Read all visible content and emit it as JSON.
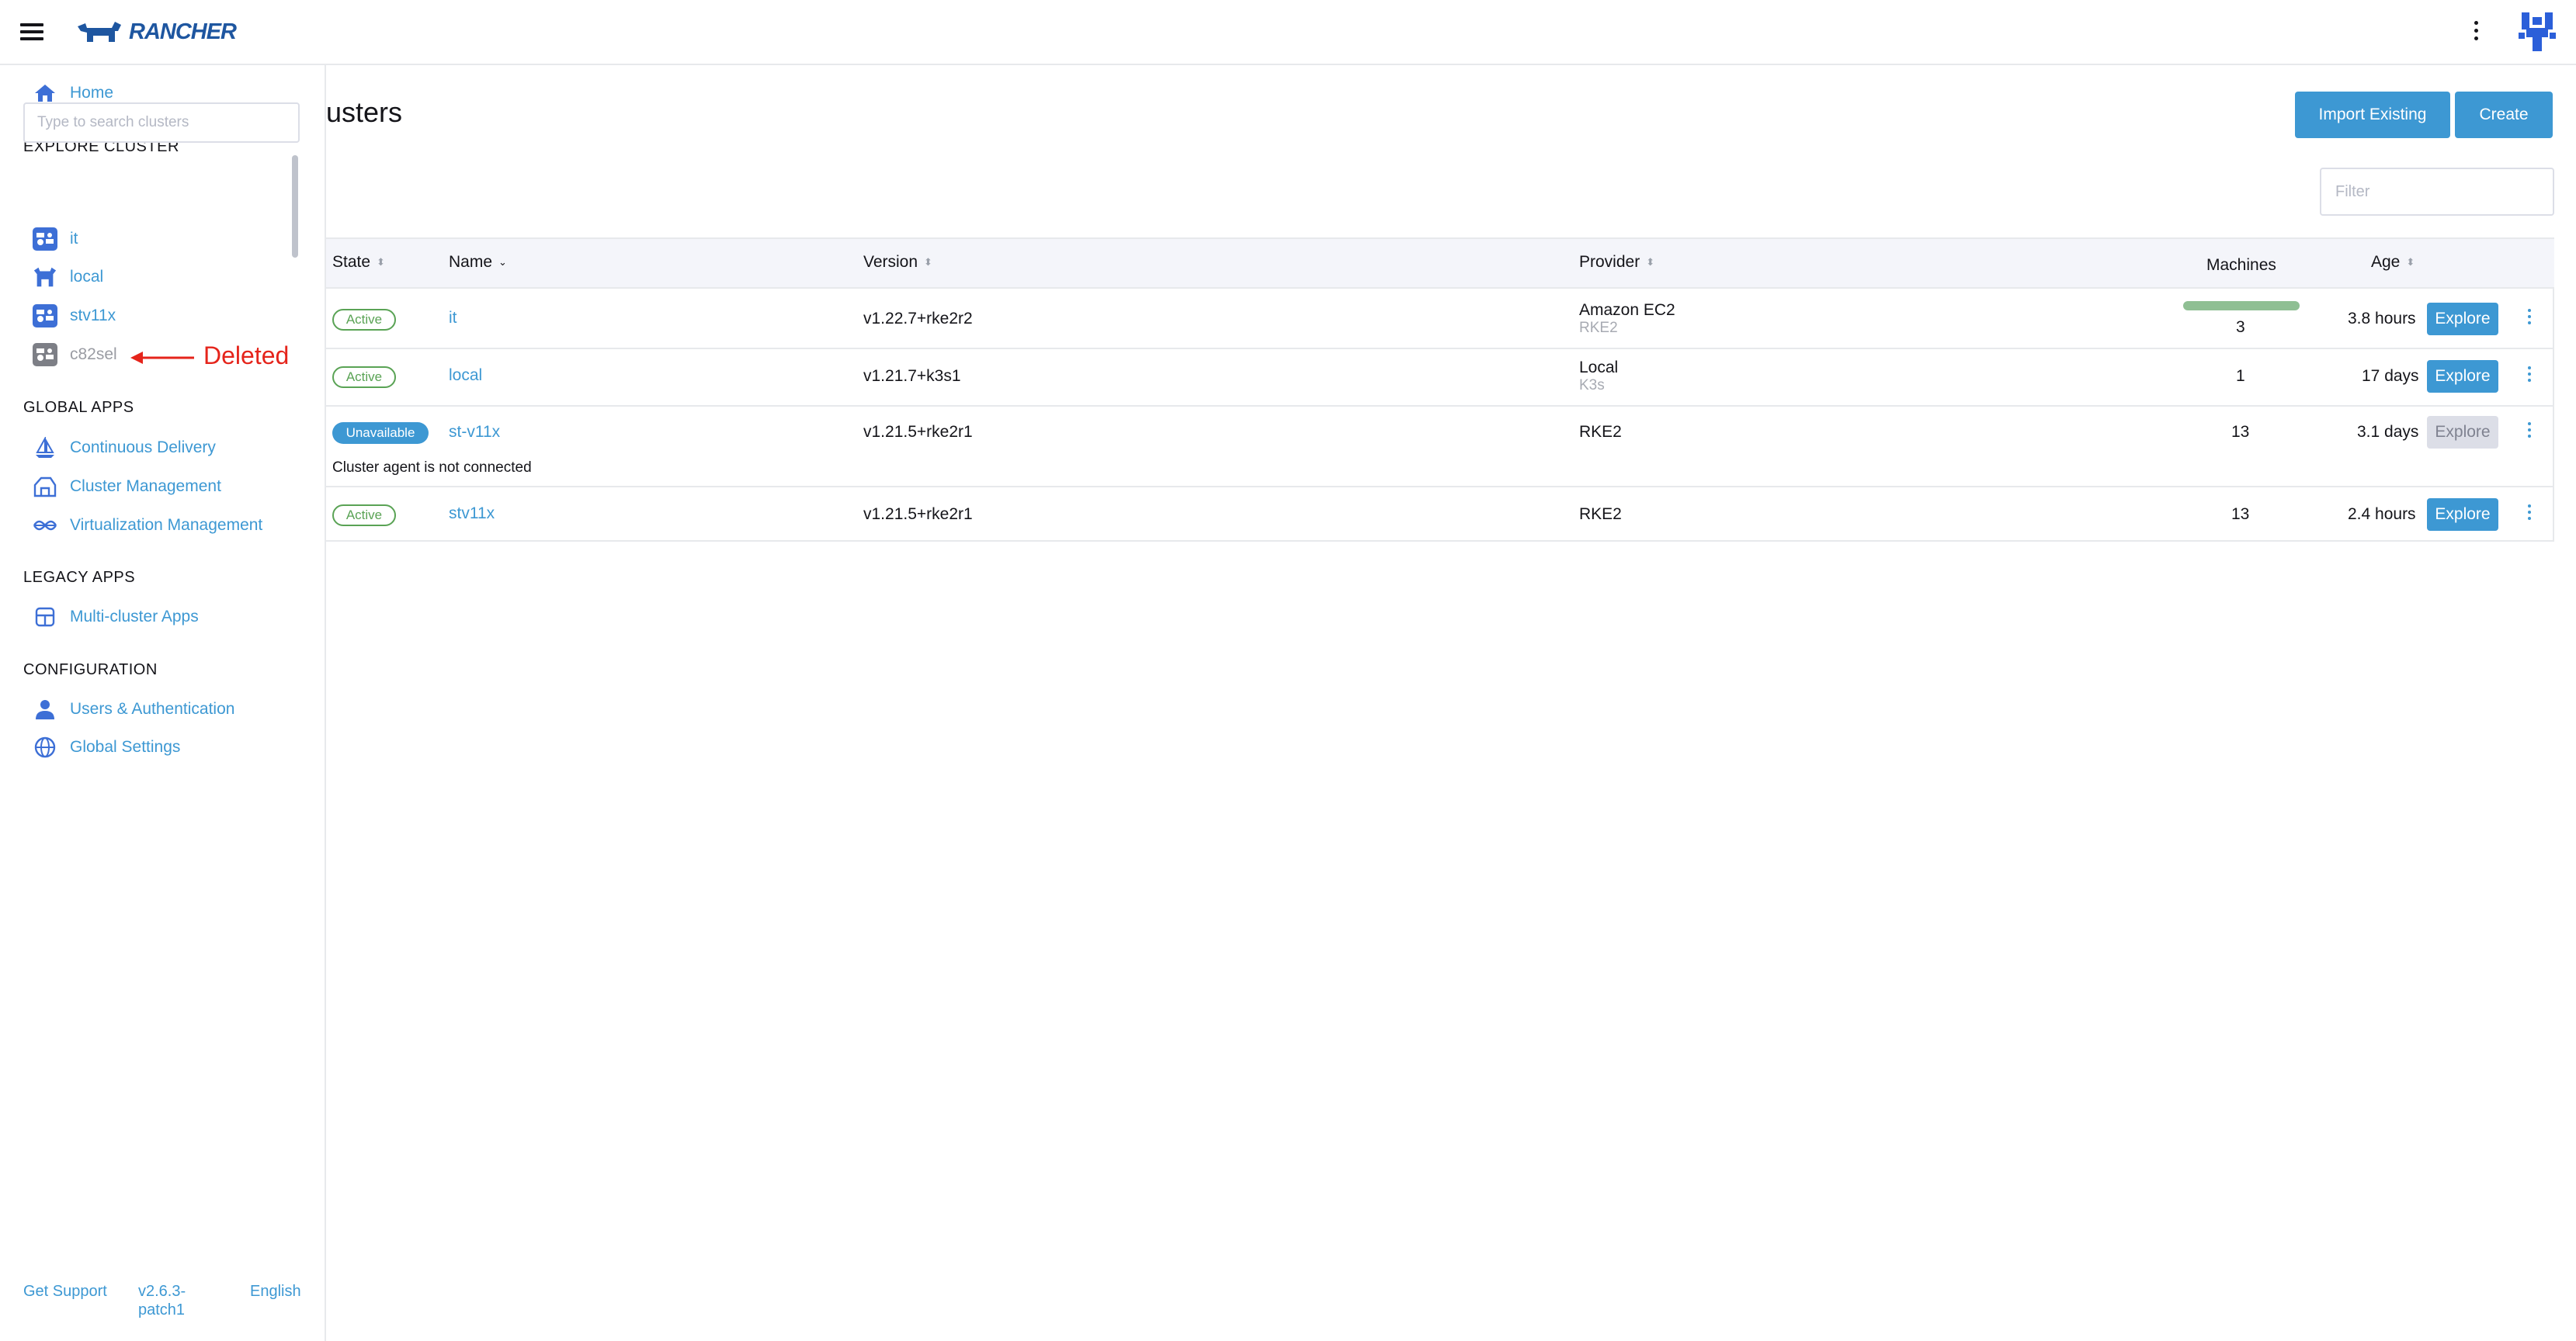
{
  "header": {
    "brand": "RANCHER"
  },
  "sidebar": {
    "home_label": "Home",
    "explore_heading": "EXPLORE CLUSTER",
    "search_placeholder": "Type to search clusters",
    "clusters": [
      {
        "name": "it",
        "state": "active"
      },
      {
        "name": "local",
        "state": "active"
      },
      {
        "name": "stv11x",
        "state": "active"
      },
      {
        "name": "c82sel",
        "state": "deleted"
      }
    ],
    "global_apps_heading": "GLOBAL APPS",
    "global_apps": [
      "Continuous Delivery",
      "Cluster Management",
      "Virtualization Management"
    ],
    "legacy_heading": "LEGACY APPS",
    "legacy_apps": [
      "Multi-cluster Apps"
    ],
    "config_heading": "CONFIGURATION",
    "config_items": [
      "Users & Authentication",
      "Global Settings"
    ],
    "footer": {
      "support": "Get Support",
      "version": "v2.6.3-patch1",
      "version_line1": "v2.6.3-",
      "version_line2": "patch1",
      "language": "English"
    }
  },
  "annotation": {
    "text": "Deleted",
    "color": "#e5241b"
  },
  "main": {
    "title": "usters",
    "import_button": "Import Existing",
    "create_button": "Create",
    "filter_placeholder": "Filter",
    "columns": {
      "state": "State",
      "name": "Name",
      "version": "Version",
      "provider": "Provider",
      "machines": "Machines",
      "age": "Age"
    },
    "rows": [
      {
        "state": "Active",
        "name": "it",
        "version": "v1.22.7+rke2r2",
        "provider": "Amazon EC2",
        "provider_sub": "RKE2",
        "machines": "3",
        "age": "3.8 hours",
        "explore": "Explore",
        "machines_ready_fraction": 1.0
      },
      {
        "state": "Active",
        "name": "local",
        "version": "v1.21.7+k3s1",
        "provider": "Local",
        "provider_sub": "K3s",
        "machines": "1",
        "age": "17 days",
        "explore": "Explore"
      },
      {
        "state": "Unavailable",
        "name": "st-v11x",
        "version": "v1.21.5+rke2r1",
        "provider": "RKE2",
        "provider_sub": "",
        "machines": "13",
        "age": "3.1 days",
        "explore": "Explore",
        "message": "Cluster agent is not connected"
      },
      {
        "state": "Active",
        "name": "stv11x",
        "version": "v1.21.5+rke2r1",
        "provider": "RKE2",
        "provider_sub": "",
        "machines": "13",
        "age": "2.4 hours",
        "explore": "Explore"
      }
    ]
  },
  "colors": {
    "accent": "#3d98d3",
    "active": "#5aa355",
    "brand": "#1e56a0"
  }
}
